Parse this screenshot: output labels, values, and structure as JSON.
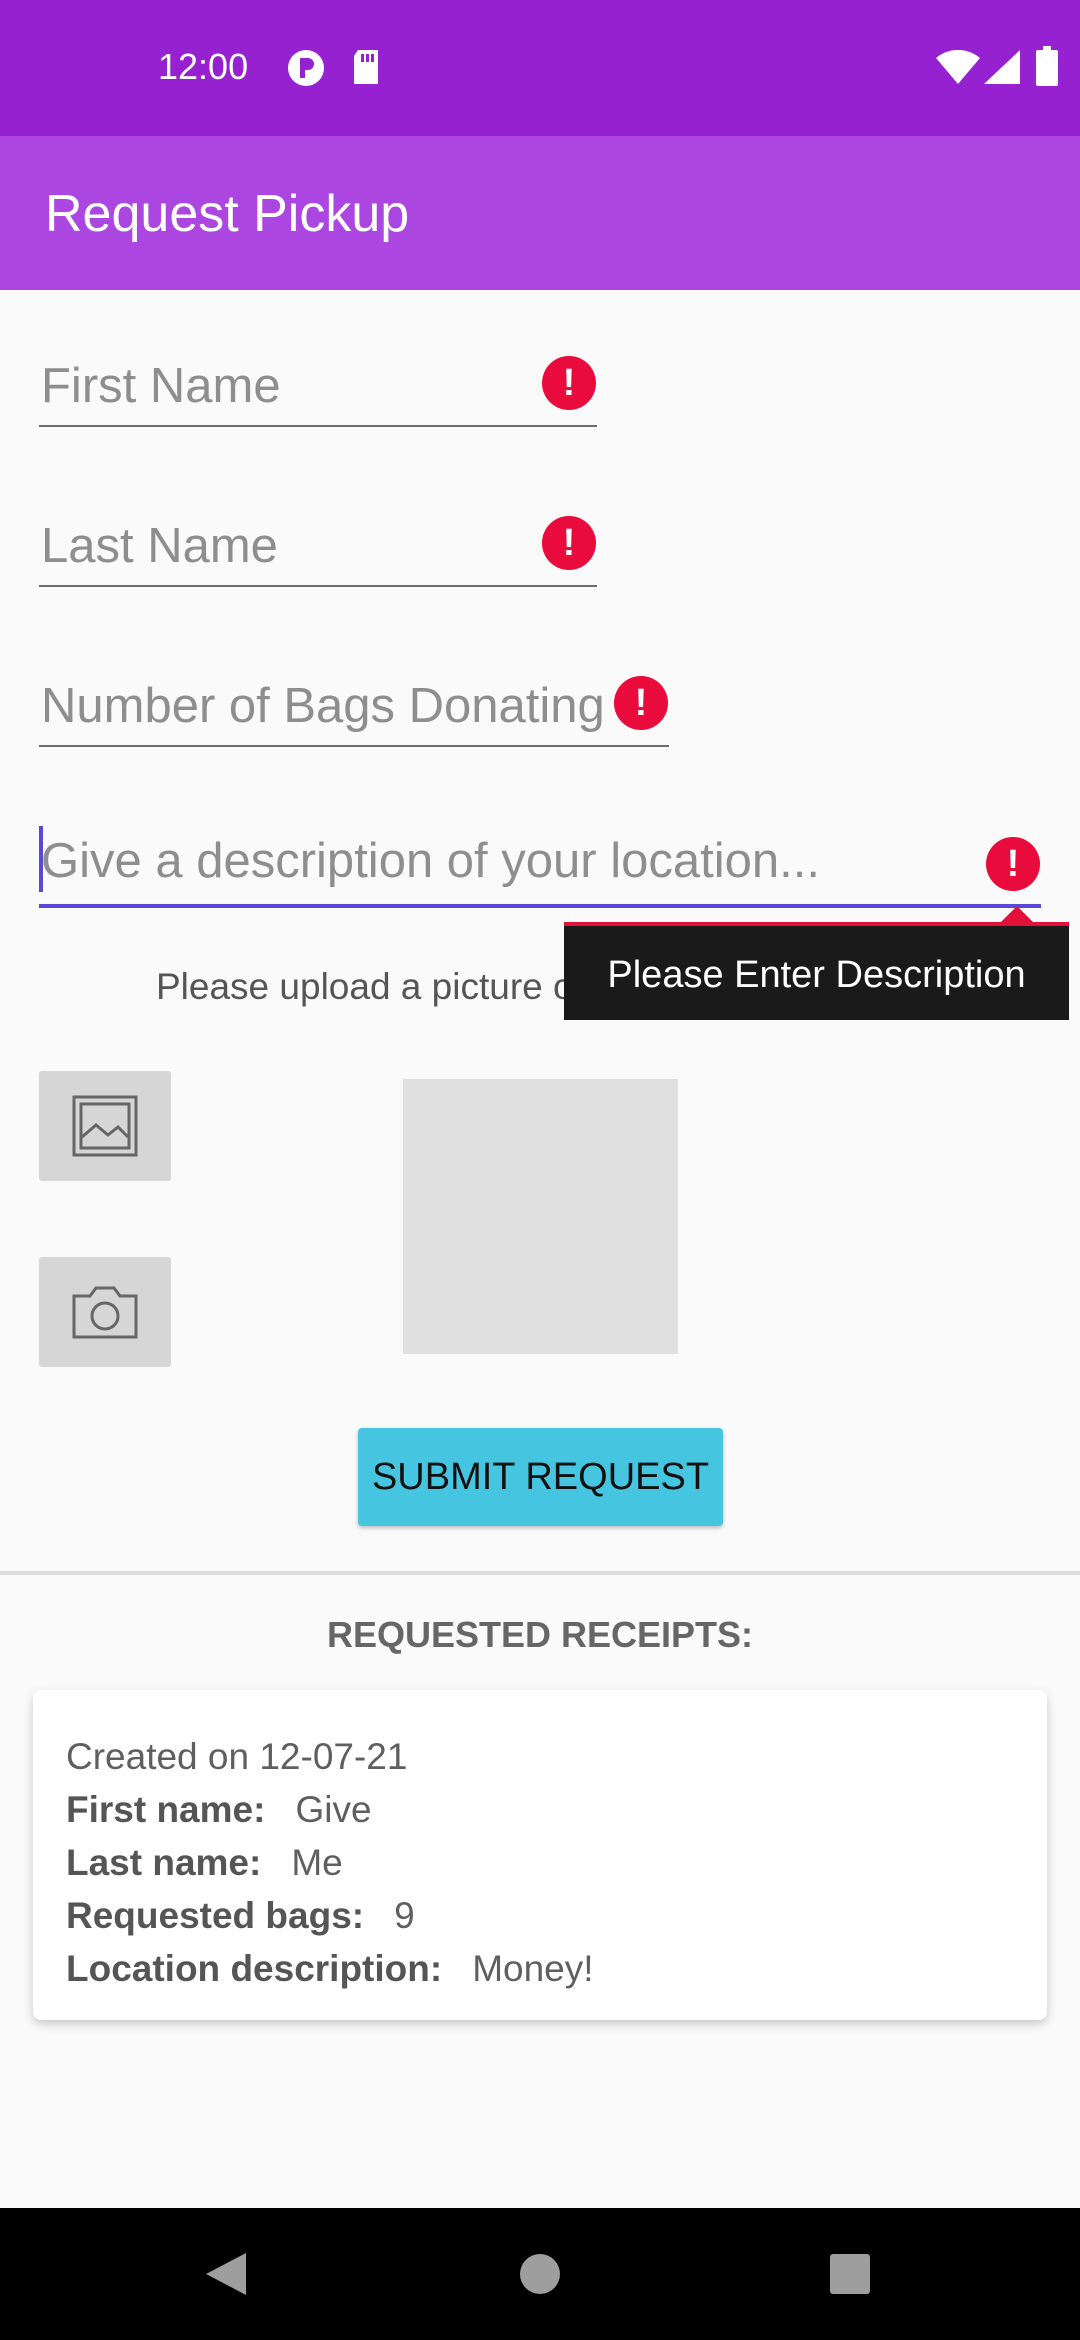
{
  "status_bar": {
    "time": "12:00"
  },
  "app_bar": {
    "title": "Request Pickup"
  },
  "form": {
    "first_name_hint": "First Name",
    "last_name_hint": "Last Name",
    "bags_hint": "Number of Bags Donating",
    "description_hint": "Give a description of your location...",
    "error_tooltip": "Please Enter Description",
    "upload_prompt": "Please upload a picture of",
    "submit_label": "SUBMIT REQUEST",
    "error_icon": "!"
  },
  "receipts": {
    "title": "REQUESTED RECEIPTS:",
    "items": [
      {
        "created": "Created on 12-07-21",
        "first_name_label": "First name:",
        "first_name": "Give",
        "last_name_label": "Last name:",
        "last_name": "Me",
        "bags_label": "Requested bags:",
        "bags": "9",
        "location_label": "Location description:",
        "location": "Money!"
      }
    ]
  },
  "icons": {
    "gallery": "gallery-icon",
    "camera": "camera-icon",
    "back": "back-icon",
    "home": "home-icon",
    "recents": "recents-icon"
  },
  "colors": {
    "status_bar": "#9621d1",
    "app_bar": "#ab47e0",
    "error": "#ea0b3d",
    "submit": "#45c5df",
    "focus": "#5b48d6"
  }
}
